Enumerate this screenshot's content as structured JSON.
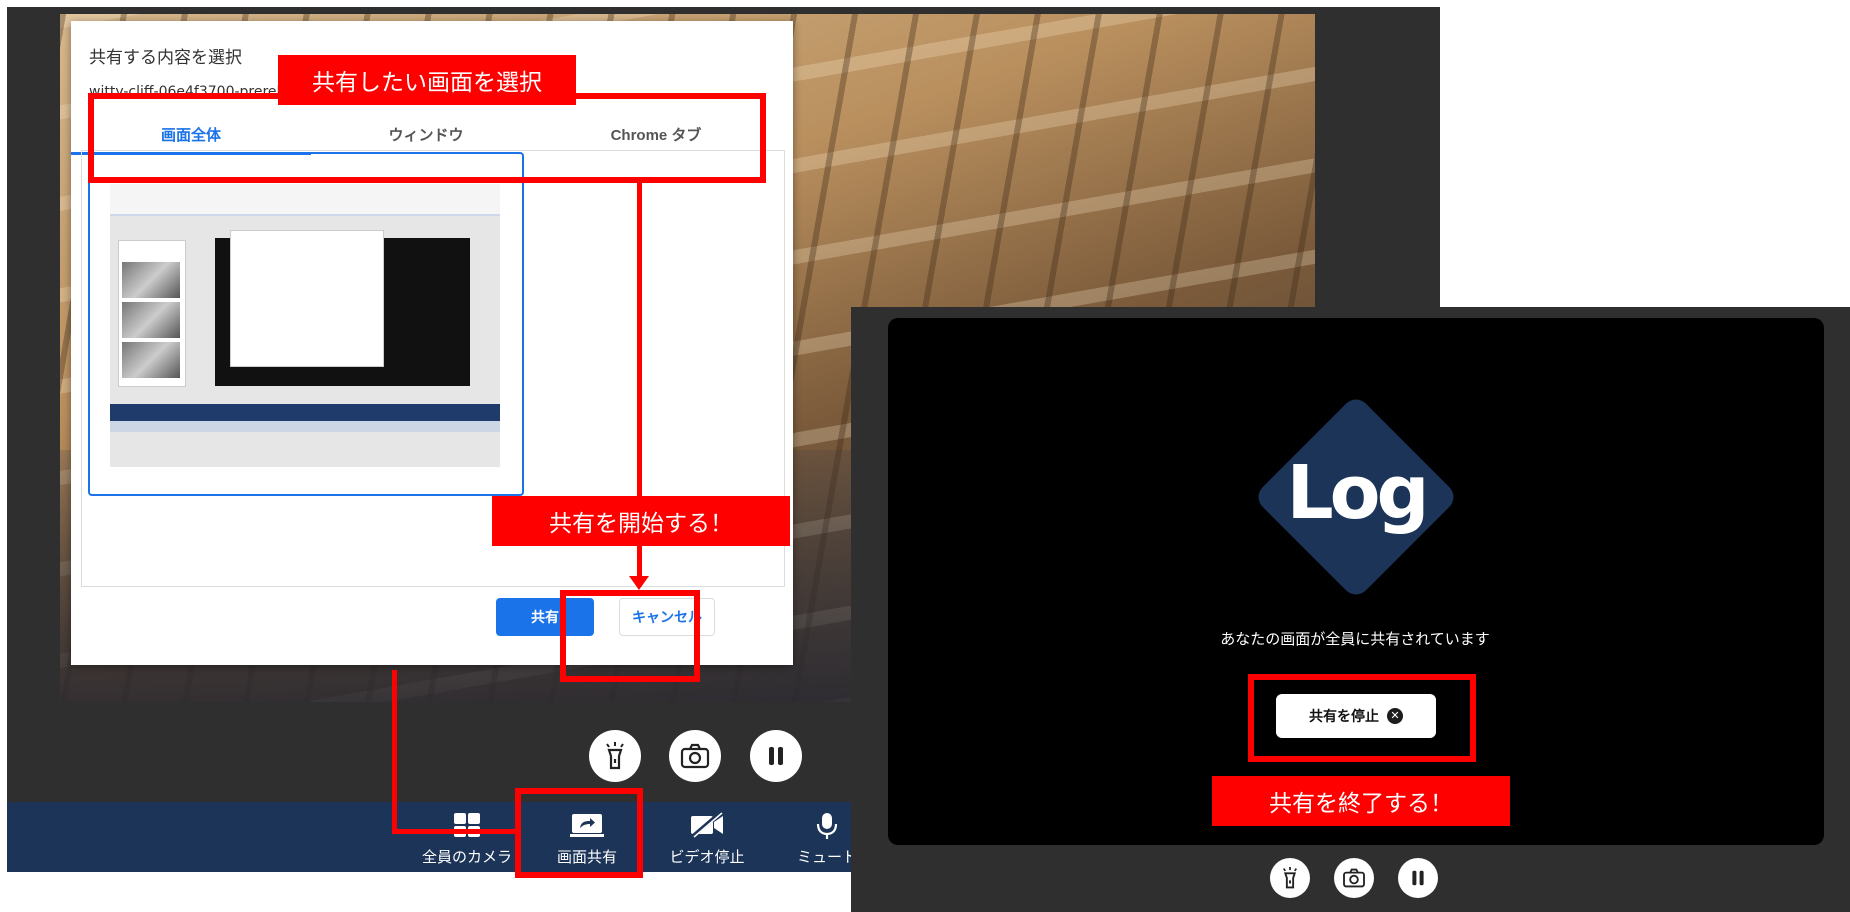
{
  "left_screen": {
    "dialog": {
      "title": "共有する内容を選択",
      "subtitle": "witty-cliff-06e4f3700-prerelea… の共有をリクエストしています",
      "tabs": [
        {
          "label": "画面全体",
          "selected": true
        },
        {
          "label": "ウィンドウ",
          "selected": false
        },
        {
          "label": "Chrome タブ",
          "selected": false
        }
      ],
      "share_label": "共有",
      "cancel_label": "キャンセル"
    },
    "controls": [
      "flashlight-icon",
      "camera-icon",
      "pause-icon"
    ],
    "bottom_nav": [
      {
        "label": "全員のカメラ",
        "icon": "grid-icon"
      },
      {
        "label": "画面共有",
        "icon": "screen-share-icon"
      },
      {
        "label": "ビデオ停止",
        "icon": "video-off-icon"
      },
      {
        "label": "ミュート",
        "icon": "microphone-icon"
      }
    ]
  },
  "right_screen": {
    "logo_text": "Log",
    "message": "あなたの画面が全員に共有されています",
    "stop_label": "共有を停止",
    "controls": [
      "flashlight-icon",
      "camera-icon",
      "pause-icon"
    ]
  },
  "annotations": {
    "select_screen": "共有したい画面を選択",
    "start_sharing": "共有を開始する！",
    "end_sharing": "共有を終了する！"
  },
  "colors": {
    "annotation_red": "#ff0000",
    "nav_bg": "#1c3458",
    "accent_blue": "#1a73e8"
  }
}
